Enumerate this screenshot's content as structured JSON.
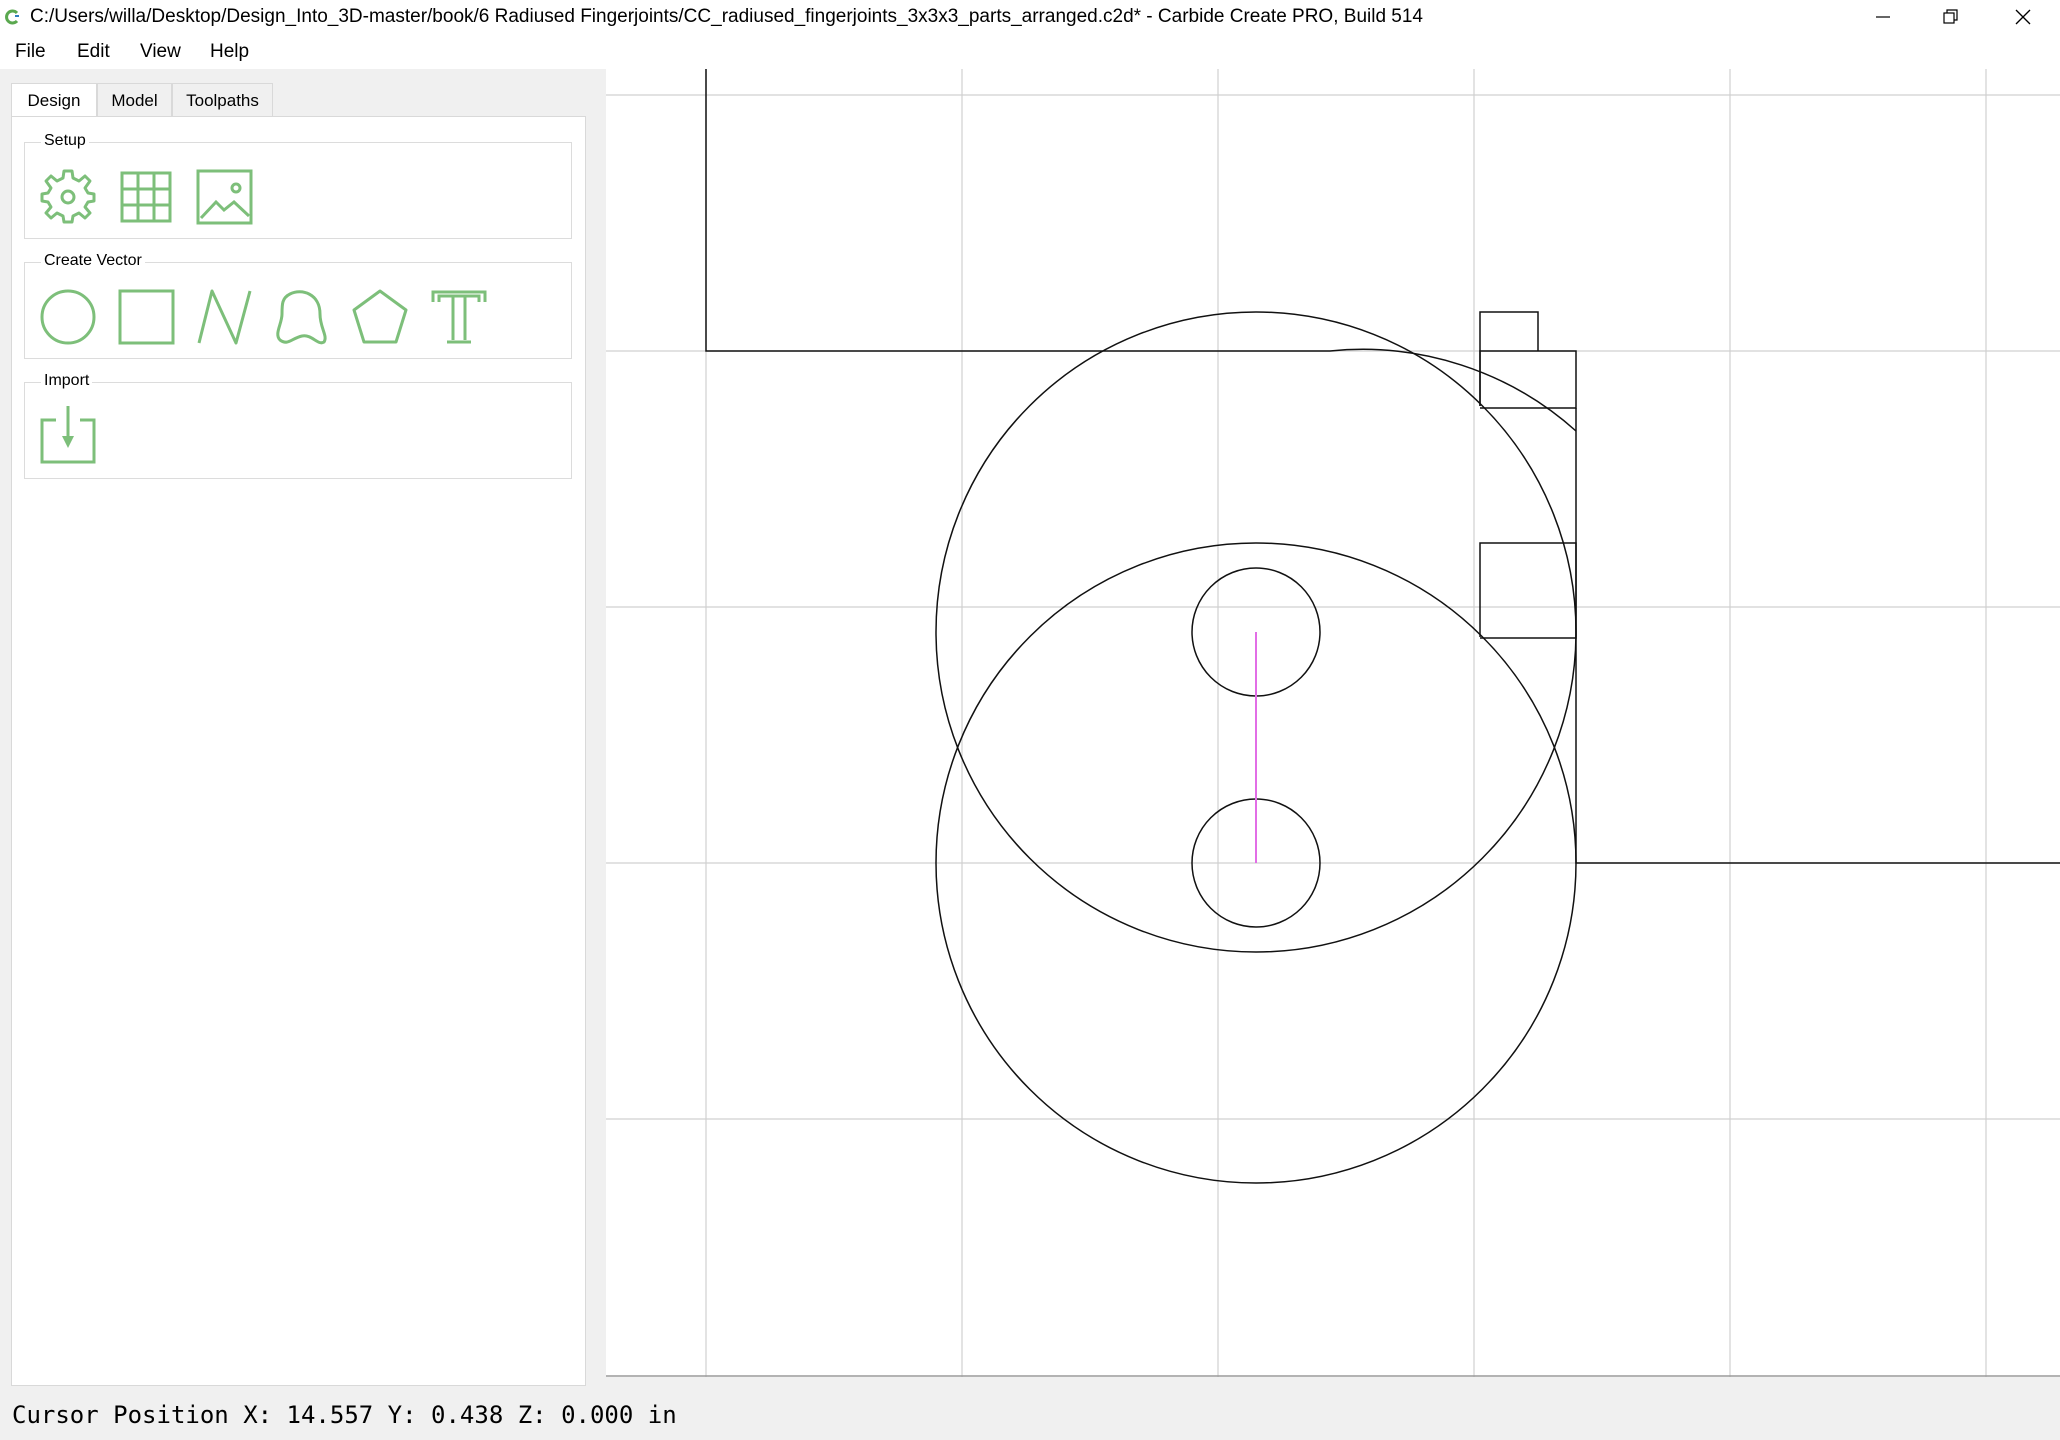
{
  "window": {
    "title": "C:/Users/willa/Desktop/Design_Into_3D-master/book/6 Radiused Fingerjoints/CC_radiused_fingerjoints_3x3x3_parts_arranged.c2d* - Carbide Create PRO, Build 514",
    "icons": [
      "carbide-logo-icon",
      "minimize-icon",
      "restore-icon",
      "close-icon"
    ]
  },
  "menu": {
    "items": [
      "File",
      "Edit",
      "View",
      "Help"
    ]
  },
  "tabs": [
    {
      "label": "Design",
      "active": true
    },
    {
      "label": "Model",
      "active": false
    },
    {
      "label": "Toolpaths",
      "active": false
    }
  ],
  "groups": {
    "setup": {
      "title": "Setup",
      "tools": [
        "gear-icon",
        "grid-icon",
        "image-icon"
      ]
    },
    "create_vector": {
      "title": "Create Vector",
      "tools": [
        "circle-icon",
        "rectangle-icon",
        "polyline-icon",
        "curve-icon",
        "polygon-icon",
        "text-icon"
      ]
    },
    "import": {
      "title": "Import",
      "tools": [
        "import-icon"
      ]
    }
  },
  "status": {
    "text": "Cursor Position X: 14.557 Y: 0.438 Z: 0.000 in"
  },
  "colors": {
    "accent_green": "#7dbf7a",
    "selection_magenta": "#e26ee6",
    "grid_line": "#d0d0d0"
  }
}
